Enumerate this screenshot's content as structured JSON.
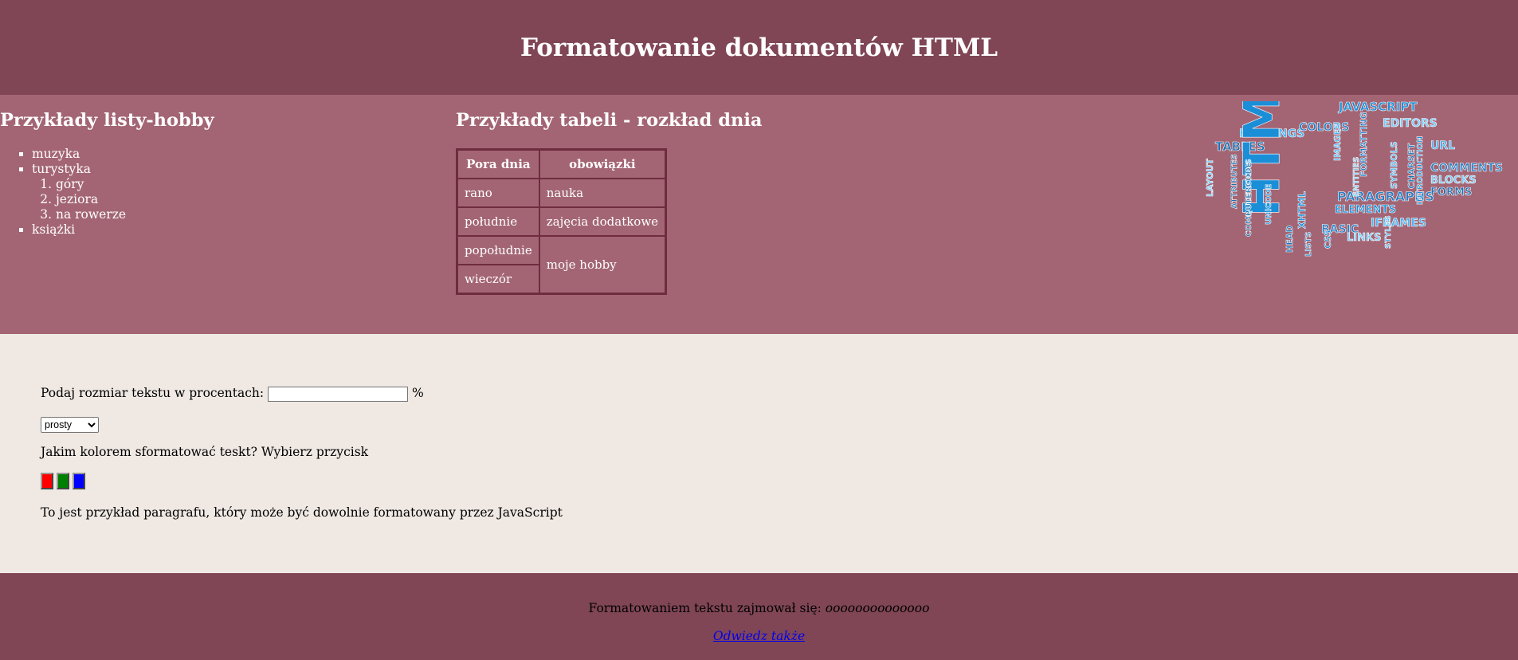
{
  "header": {
    "title": "Formatowanie dokumentów HTML"
  },
  "hobby": {
    "title": "Przykłady listy-hobby",
    "items": [
      "muzyka",
      "turystyka",
      "książki"
    ],
    "sub_items": [
      "góry",
      "jeziora",
      "na rowerze"
    ]
  },
  "schedule": {
    "title": "Przykłady tabeli - rozkład dnia",
    "headers": [
      "Pora dnia",
      "obowiązki"
    ],
    "rows": [
      [
        "rano",
        "nauka"
      ],
      [
        "południe",
        "zajęcia dodatkowe"
      ],
      [
        "popołudnie",
        "moje hobby"
      ],
      [
        "wieczór",
        ""
      ]
    ]
  },
  "cloud": {
    "words": [
      "JAVASCRIPT",
      "HEADINGS",
      "COLORS",
      "EDITORS",
      "TABLES",
      "HTML",
      "URL",
      "COMMENTS",
      "LAYOUT",
      "ATTRIBUTES",
      "UNICODE",
      "IMAGES",
      "PARAGRAPHS",
      "BLOCKS",
      "FORMS",
      "ELEMENTS",
      "IFRAMES",
      "BASIC",
      "LINKS",
      "HEAD",
      "CSS",
      "SYMBOLS",
      "FORMATTING",
      "ENTITIES",
      "CHARSET",
      "INTRODUCTION",
      "STYLES",
      "LISTS",
      "QUOTATIONS",
      "COMPUTERCODE",
      "XHTML"
    ]
  },
  "form": {
    "size_label": "Podaj rozmiar tekstu w procentach:",
    "size_value": "",
    "size_unit": "%",
    "style_selected": "prosty",
    "color_question": "Jakim kolorem sformatować teskt? Wybierz przycisk",
    "button_colors": [
      "#ff0000",
      "#008000",
      "#0000ff"
    ],
    "paragraph": "To jest przykład paragrafu, który może być dowolnie formatowany przez JavaScript"
  },
  "footer": {
    "label": "Formatowaniem tekstu zajmował się:",
    "author": "oooooooooooooo",
    "link": "Odwiedz także"
  }
}
